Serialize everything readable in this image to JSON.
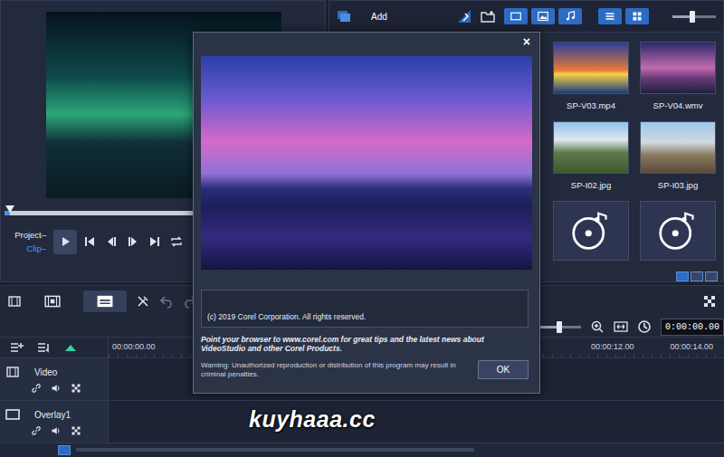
{
  "preview": {
    "scrubber": {
      "level": 0.03
    },
    "modes": [
      {
        "label": "Project–",
        "selected": false
      },
      {
        "label": "Clip–",
        "selected": true
      }
    ]
  },
  "library": {
    "add_button": "Add",
    "zoom": {
      "level": 0.45
    },
    "items": [
      {
        "label": "SP-V03.mp4",
        "kind": "video"
      },
      {
        "label": "SP-V04.wmv",
        "kind": "video"
      },
      {
        "label": "SP-I02.jpg",
        "kind": "image"
      },
      {
        "label": "SP-I03.jpg",
        "kind": "image"
      },
      {
        "kind": "audio"
      },
      {
        "kind": "audio"
      }
    ]
  },
  "timeline": {
    "view_buttons": [
      {
        "kind": "timeline",
        "selected": false
      },
      {
        "kind": "storyboard",
        "selected": true
      }
    ],
    "zoom": {
      "level": 0.5
    },
    "timecode": "0:00:00.00",
    "ruler": [
      "00:00:00.00",
      "00:00:12.00",
      "00:00:14.00"
    ],
    "tracks": [
      {
        "label": "Video"
      },
      {
        "label": "Overlay1"
      }
    ]
  },
  "dialog": {
    "close": "×",
    "copyright": "(c) 2019 Corel Corporation. All rights reserved.",
    "tip": "Point your browser to www.corel.com for great tips and the latest news about VideoStudio and other Corel Products.",
    "warning": "Warning: Unauthorized reproduction or distribution of this program may result in criminal penalties.",
    "buttons": [
      "OK"
    ]
  },
  "watermark": "kuyhaaa.cc"
}
